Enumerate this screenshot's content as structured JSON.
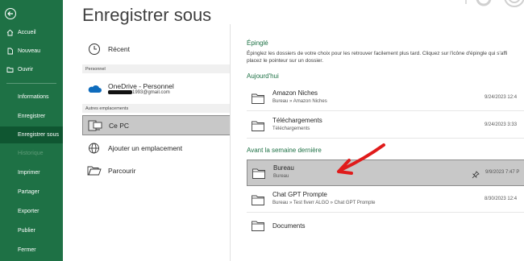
{
  "window": {
    "title": "Enregistrer sous"
  },
  "nav": {
    "back_icon": "back-arrow-icon",
    "items": [
      {
        "label": "Accueil",
        "icon": "home-icon"
      },
      {
        "label": "Nouveau",
        "icon": "new-document-icon"
      },
      {
        "label": "Ouvrir",
        "icon": "open-folder-icon"
      },
      {
        "label": "Informations"
      },
      {
        "label": "Enregistrer"
      },
      {
        "label": "Enregistrer sous",
        "active": true
      },
      {
        "label": "Historique",
        "disabled": true
      },
      {
        "label": "Imprimer"
      },
      {
        "label": "Partager"
      },
      {
        "label": "Exporter"
      },
      {
        "label": "Publier"
      },
      {
        "label": "Fermer"
      }
    ],
    "colors": {
      "background": "#1e7145",
      "active": "#0f5631"
    }
  },
  "locations": {
    "recent_label": "Récent",
    "personal_header": "Personnel",
    "onedrive_label": "OneDrive - Personnel",
    "onedrive_email_suffix": "1993@gmail.com",
    "other_header": "Autres emplacements",
    "this_pc_label": "Ce PC",
    "add_location_label": "Ajouter un emplacement",
    "browse_label": "Parcourir"
  },
  "pinned": {
    "title": "Épinglé",
    "hint_line1": "Épinglez les dossiers de votre choix pour les retrouver facilement plus tard. Cliquez sur l'icône d'épingle qui s'affi",
    "hint_line2": "placez le pointeur sur un dossier."
  },
  "today": {
    "title": "Aujourd'hui",
    "folders": [
      {
        "name": "Amazon Niches",
        "path": "Bureau » Amazon Niches",
        "date": "9/24/2023 12:4"
      },
      {
        "name": "Téléchargements",
        "path": "Téléchargements",
        "date": "9/24/2023 3:33"
      }
    ]
  },
  "last_week": {
    "title": "Avant la semaine dernière",
    "folders": [
      {
        "name": "Bureau",
        "path": "Bureau",
        "date": "9/9/2023 7:47 P",
        "selected": true
      },
      {
        "name": "Chat GPT Prompte",
        "path": "Bureau » Test fiverr ALGO » Chat GPT Prompte",
        "date": "8/30/2023 12:4"
      },
      {
        "name": "Documents",
        "path": "",
        "date": ""
      }
    ]
  },
  "annotation": {
    "arrow_color": "#e01b1b"
  }
}
